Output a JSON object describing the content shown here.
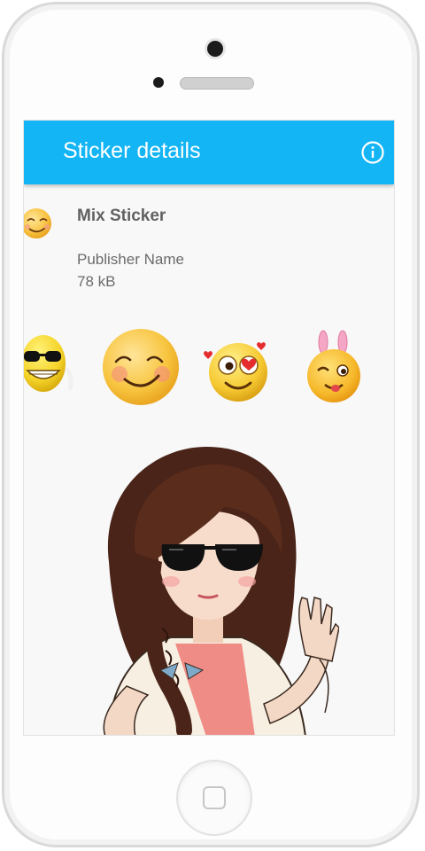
{
  "theme": {
    "accent": "#13b5f5"
  },
  "app_bar": {
    "title": "Sticker details",
    "info_icon": "info-circle-icon"
  },
  "pack": {
    "name": "Mix Sticker",
    "publisher": "Publisher Name",
    "size": "78 kB",
    "icon": "smiling-face-sticker"
  },
  "stickers": [
    {
      "name": "sunglasses-grin-sticker"
    },
    {
      "name": "smiling-blush-sticker"
    },
    {
      "name": "heart-eyes-sticker"
    },
    {
      "name": "bunny-ears-wink-sticker"
    }
  ],
  "preview": {
    "name": "girl-sunglasses-waving-sticker"
  }
}
